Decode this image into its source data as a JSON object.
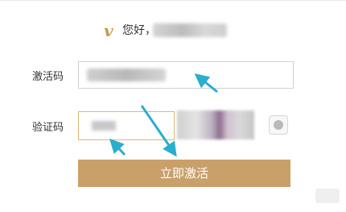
{
  "header": {
    "logo_glyph": "v",
    "greeting": "您好，"
  },
  "form": {
    "code_label": "激活码",
    "verify_label": "验证码",
    "submit_label": "立即激活"
  },
  "colors": {
    "brand": "#c79a4a",
    "submit_bg": "#c9a06a",
    "arrow": "#2aaecd",
    "input_border": "#d0d0d0",
    "verify_border": "#e0b97a"
  },
  "icons": {
    "refresh": "refresh-icon",
    "logo": "v-logo-icon"
  }
}
